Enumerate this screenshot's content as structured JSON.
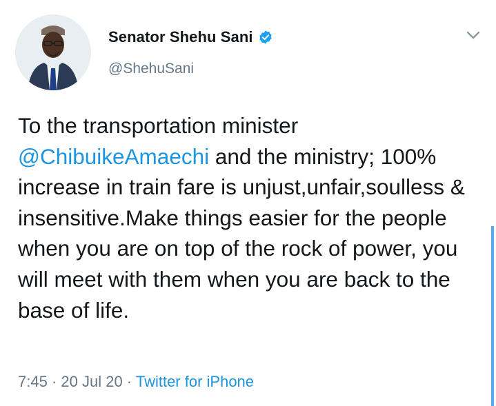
{
  "author": {
    "display_name": "Senator Shehu Sani",
    "handle": "@ShehuSani",
    "verified": true
  },
  "tweet": {
    "text_before_mention": "To the transportation minister\n",
    "mention": "@ChibuikeAmaechi",
    "text_after_mention": " and the ministry; 100% increase in train fare is unjust,unfair,soulless & insensitive.Make things easier for the people when you are on top of the rock of power, you will meet with them when you are back to the base of life."
  },
  "meta": {
    "time": "7:45",
    "separator": " · ",
    "date": "20 Jul 20",
    "source": "Twitter for iPhone"
  },
  "colors": {
    "link": "#1b95e0",
    "secondary_text": "#657786",
    "primary_text": "#14171a",
    "verified_badge": "#1da1f2"
  },
  "icons": {
    "verified": "verified-badge-icon",
    "caret": "chevron-down-icon"
  }
}
